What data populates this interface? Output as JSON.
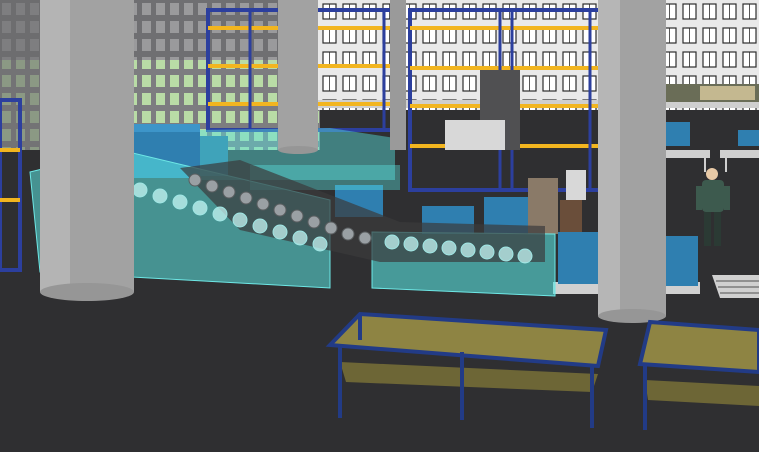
{
  "scene": {
    "kind": "3d-warehouse-render",
    "palette": {
      "floor": "#2f2f31",
      "wall_building": "#8c8c8e",
      "window_green": "#b9dca6",
      "window_white": "#f2f2f2",
      "column": "#9a9a9a",
      "rack_blue": "#2c3f9e",
      "rack_beam_yellow": "#f2b51f",
      "glass_cyan": "#59e3e0",
      "machine_blue": "#2f7fb0",
      "table_top": "#8e8443",
      "table_frame": "#223b86",
      "pallet": "#cfcfcf"
    },
    "objects": [
      "left-building-facade",
      "right-building-facade",
      "storage-racks",
      "support-columns",
      "glass-enclosure",
      "roller-conveyor",
      "machine-blocks",
      "work-tables",
      "pallets",
      "worker-figure",
      "side-workbenches"
    ]
  }
}
